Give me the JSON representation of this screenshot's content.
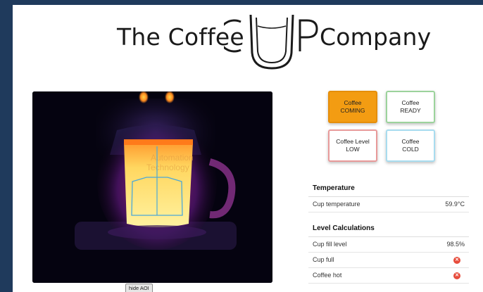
{
  "header": {
    "brand_left": "The Coffee",
    "brand_right": "Company",
    "logo_letters": "CUP"
  },
  "camera": {
    "hide_aoi_label": "hide AOI",
    "watermark_line1": "Automation",
    "watermark_line2": "Technology"
  },
  "status_tiles": [
    {
      "line1": "Coffee",
      "line2": "COMING",
      "color": "#f39c12",
      "active": true
    },
    {
      "line1": "Coffee",
      "line2": "READY",
      "color": "#9cd39c",
      "active": false
    },
    {
      "line1": "Coffee Level",
      "line2": "LOW",
      "color": "#e89a9a",
      "active": false
    },
    {
      "line1": "Coffee",
      "line2": "COLD",
      "color": "#a8dcef",
      "active": false
    }
  ],
  "temperature": {
    "title": "Temperature",
    "rows": [
      {
        "label": "Cup temperature",
        "value": "59.9°C"
      }
    ]
  },
  "level": {
    "title": "Level Calculations",
    "rows": [
      {
        "label": "Cup fill level",
        "value": "98.5%"
      },
      {
        "label": "Cup full",
        "icon": "x-circle-icon",
        "status": "false"
      },
      {
        "label": "Coffee hot",
        "icon": "x-circle-icon",
        "status": "false"
      }
    ]
  }
}
